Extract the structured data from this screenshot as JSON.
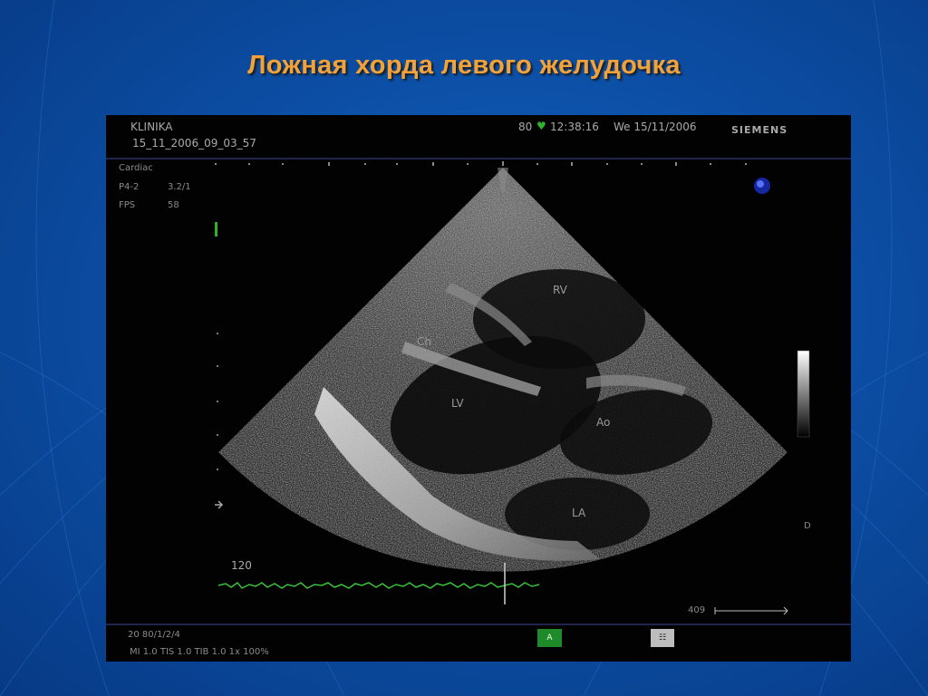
{
  "slide": {
    "title": "Ложная хорда левого желудочка",
    "colors": {
      "background": "#0c4fa6",
      "title": "#f2a23a"
    }
  },
  "ultrasound": {
    "header": {
      "clinic": "KLINIKA",
      "file": "15_11_2006_09_03_57",
      "heart_rate": "80",
      "heart_icon": "heart-icon",
      "time": "12:38:16",
      "date": "We 15/11/2006",
      "brand": "SIEMENS"
    },
    "settings": {
      "preset": "Cardiac",
      "probe": "P4-2",
      "probe_value": "3.2/1",
      "fps_label": "FPS",
      "fps_value": "58"
    },
    "structures": [
      "RV",
      "Ch",
      "LV",
      "Ao",
      "LA"
    ],
    "ecg_label": "120",
    "depth_label": "D",
    "scale_value": "409",
    "footer": {
      "line1": "20 80/1/2/4",
      "line2": "MI 1.0   TIS 1.0   TIB 1.0   1x   100%",
      "mode_badge": "A",
      "menu_icon": "grid-icon"
    }
  }
}
